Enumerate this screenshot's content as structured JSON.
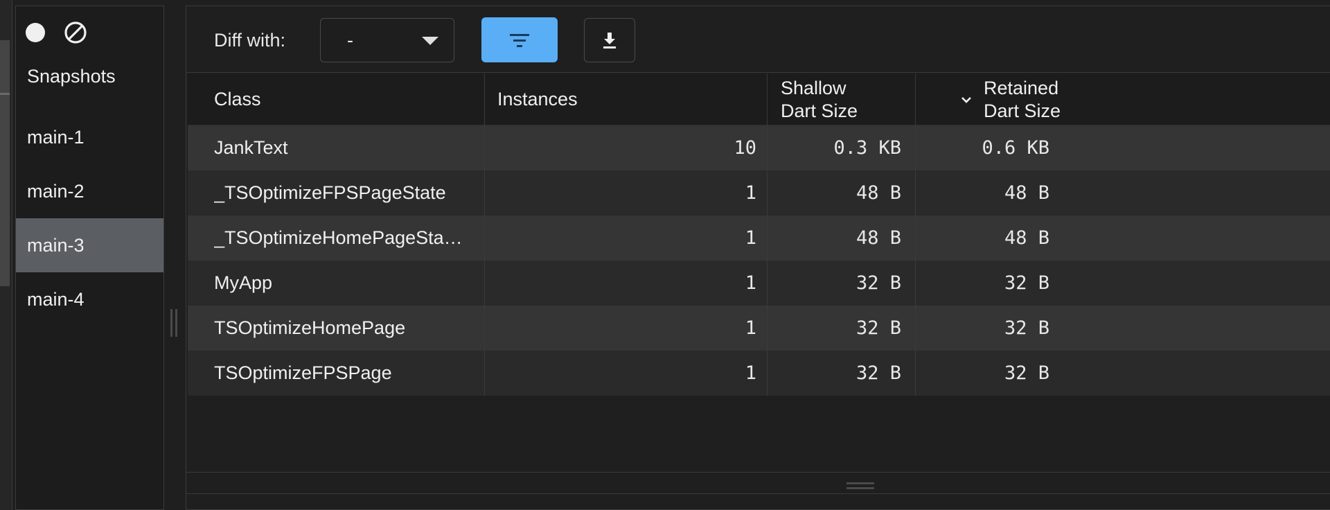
{
  "sidebar": {
    "heading": "Snapshots",
    "items": [
      {
        "label": "main-1",
        "selected": false
      },
      {
        "label": "main-2",
        "selected": false
      },
      {
        "label": "main-3",
        "selected": true
      },
      {
        "label": "main-4",
        "selected": false
      }
    ],
    "toolbar_icons": [
      "record-icon",
      "clear-icon"
    ]
  },
  "toolbar": {
    "diff_label": "Diff with:",
    "diff_value": "-",
    "filter_icon": "filter-icon",
    "download_icon": "download-icon",
    "accent_color": "#5aaef5"
  },
  "table": {
    "headers": {
      "class": "Class",
      "instances": "Instances",
      "shallow_1": "Shallow",
      "shallow_2": "Dart Size",
      "retained_1": "Retained",
      "retained_2": "Dart Size"
    },
    "sort_column": "retained",
    "rows": [
      {
        "class": "JankText",
        "instances": "10",
        "shallow": "0.3 KB",
        "retained": "0.6 KB"
      },
      {
        "class": "_TSOptimizeFPSPageState",
        "instances": "1",
        "shallow": "48 B",
        "retained": "48 B"
      },
      {
        "class": "_TSOptimizeHomePageSta…",
        "instances": "1",
        "shallow": "48 B",
        "retained": "48 B"
      },
      {
        "class": "MyApp",
        "instances": "1",
        "shallow": "32 B",
        "retained": "32 B"
      },
      {
        "class": "TSOptimizeHomePage",
        "instances": "1",
        "shallow": "32 B",
        "retained": "32 B"
      },
      {
        "class": "TSOptimizeFPSPage",
        "instances": "1",
        "shallow": "32 B",
        "retained": "32 B"
      }
    ]
  }
}
